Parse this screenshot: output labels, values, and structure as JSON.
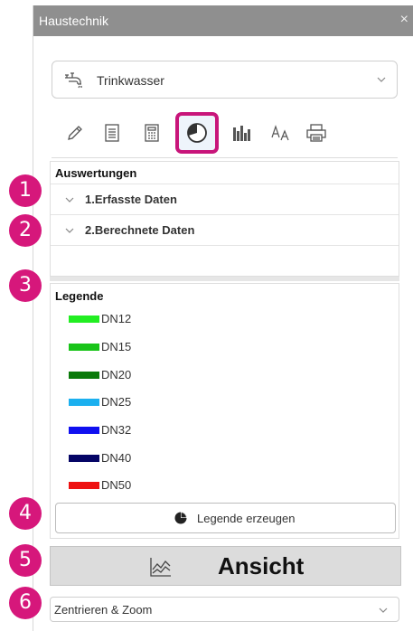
{
  "window": {
    "title": "Haustechnik",
    "close_glyph": "×"
  },
  "system_select": {
    "value": "Trinkwasser",
    "icon": "faucet-icon"
  },
  "toolbar": {
    "buttons": [
      "pencil-icon",
      "document-list-icon",
      "calculator-icon",
      "pie-chart-icon",
      "bar-chart-icon",
      "text-style-icon",
      "printer-icon"
    ],
    "active": "pie-chart-icon",
    "active_highlight_color": "#c8157a"
  },
  "evaluations": {
    "header": "Auswertungen",
    "items": [
      {
        "label": "1.Erfasste Daten"
      },
      {
        "label": "2.Berechnete Daten"
      }
    ]
  },
  "legend": {
    "header": "Legende",
    "items": [
      {
        "label": "DN12",
        "color": "#22ee22"
      },
      {
        "label": "DN15",
        "color": "#19c419"
      },
      {
        "label": "DN20",
        "color": "#0a7a0a"
      },
      {
        "label": "DN25",
        "color": "#1bb0ef"
      },
      {
        "label": "DN32",
        "color": "#1010f0"
      },
      {
        "label": "DN40",
        "color": "#050566"
      },
      {
        "label": "DN50",
        "color": "#ee1111"
      }
    ],
    "generate_button": "Legende erzeugen"
  },
  "view_button": {
    "label": "Ansicht"
  },
  "zoom_select": {
    "value": "Zentrieren & Zoom"
  },
  "annotations": {
    "badges": [
      "1",
      "2",
      "3",
      "4",
      "5",
      "6"
    ],
    "badge_color": "#d6177b"
  }
}
